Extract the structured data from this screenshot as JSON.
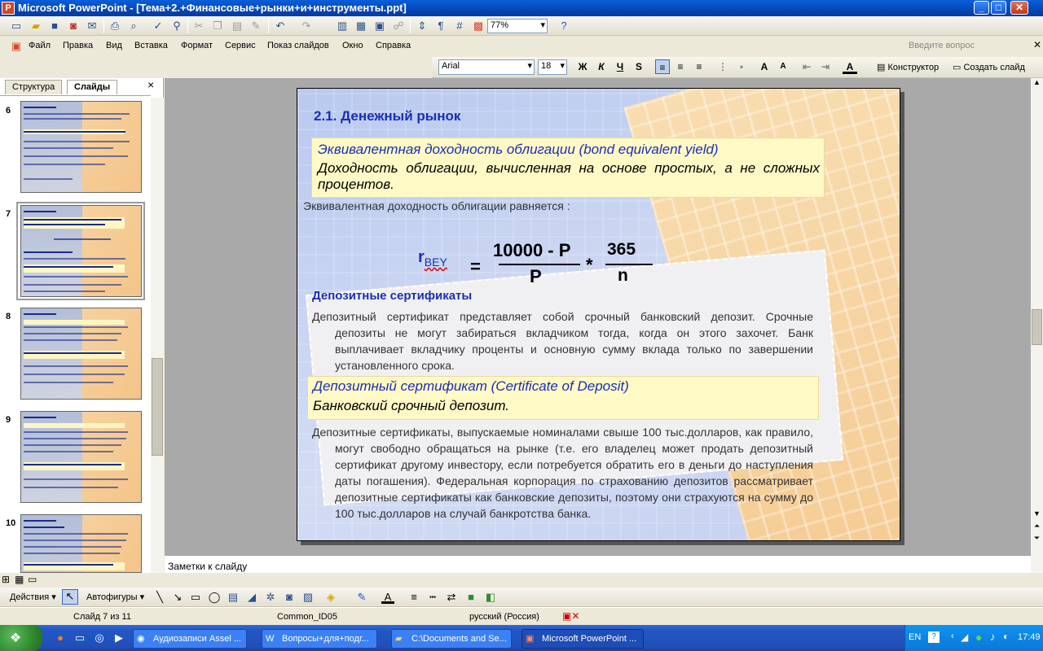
{
  "app": {
    "title": "Microsoft PowerPoint - [Тема+2.+Финансовые+рынки+и+инструменты.ppt]",
    "icon": "P"
  },
  "standard_toolbar": {
    "zoom": "77%",
    "icons": [
      "new-icon",
      "open-icon",
      "save-icon",
      "permission-icon",
      "email-icon",
      "print-icon",
      "print-preview-icon",
      "spelling-icon",
      "research-icon",
      "cut-icon",
      "copy-icon",
      "paste-icon",
      "format-painter-icon",
      "undo-icon",
      "redo-icon",
      "chart-icon",
      "table-icon",
      "tables-borders-icon",
      "insert-hyperlink-icon",
      "expand-icon",
      "show-formatting-icon",
      "grid-icon",
      "color-icon",
      "help-icon"
    ]
  },
  "menu": {
    "items": [
      "Файл",
      "Правка",
      "Вид",
      "Вставка",
      "Формат",
      "Сервис",
      "Показ слайдов",
      "Окно",
      "Справка"
    ],
    "ask_placeholder": "Введите вопрос"
  },
  "formatting_toolbar": {
    "font": "Arial",
    "size": "18",
    "bold": "Ж",
    "italic": "К",
    "underline": "Ч",
    "shadow": "S",
    "design_button": "Конструктор",
    "new_slide_button": "Создать слайд"
  },
  "left_pane": {
    "tabs": [
      "Структура",
      "Слайды"
    ],
    "close": "×",
    "thumbnails": [
      {
        "number": "6"
      },
      {
        "number": "7",
        "selected": true
      },
      {
        "number": "8"
      },
      {
        "number": "9"
      },
      {
        "number": "10"
      }
    ]
  },
  "slide": {
    "title": "2.1. Денежный рынок",
    "def1_term": "Эквивалентная доходность облигации (bond equivalent yield)",
    "def1_desc": "Доходность облигации, вычисленная на основе простых, а не сложных процентов.",
    "line1": "Эквивалентная доходность облигации равняется :",
    "formula": {
      "lhs_main": "r",
      "lhs_sub": "BEY",
      "eq": "=",
      "num1": "10000 - P",
      "den1": "P",
      "times": "*",
      "num2": "365",
      "den2": "n"
    },
    "section2": "Депозитные сертификаты",
    "para1": "Депозитный сертификат представляет собой срочный банковский депозит. Срочные депозиты не могут забираться вкладчиком тогда, когда он этого захочет. Банк выплачивает вкладчику проценты и основную сумму вклада только по завершении установленного срока.",
    "def2_term": "Депозитный сертификат (Certificate of Deposit)",
    "def2_desc": "Банковский срочный депозит.",
    "para2": "Депозитные сертификаты, выпускаемые номиналами свыше 100 тыс.долларов, как правило, могут свободно обращаться на рынке (т.е. его владелец может продать депозитный сертификат другому инвестору, если потребуется обратить его в деньги до наступления даты погашения). Федеральная корпорация по страхованию депозитов рассматривает депозитные сертификаты как банковские депозиты, поэтому они страхуются на сумму до 100 тыс.долларов на случай банкротства банка."
  },
  "notes": {
    "label": "Заметки к слайду"
  },
  "drawing_toolbar": {
    "actions": "Действия",
    "autoshapes": "Автофигуры"
  },
  "status": {
    "slide": "Слайд 7 из 11",
    "design": "Common_ID05",
    "language": "русский (Россия)"
  },
  "taskbar": {
    "start": "",
    "tasks": [
      {
        "label": "Аудиозаписи Assel ..."
      },
      {
        "label": "Вопросы+для+подг..."
      },
      {
        "label": "C:\\Documents and Se..."
      },
      {
        "label": "Microsoft PowerPoint ...",
        "active": true
      }
    ],
    "lang": "EN",
    "time": "17:49"
  },
  "colors": {
    "title_bar": "#0a5ed8",
    "slide_title": "#1a2fb5",
    "definition_bg": "#fff9c6",
    "taskbar": "#2457c4"
  }
}
